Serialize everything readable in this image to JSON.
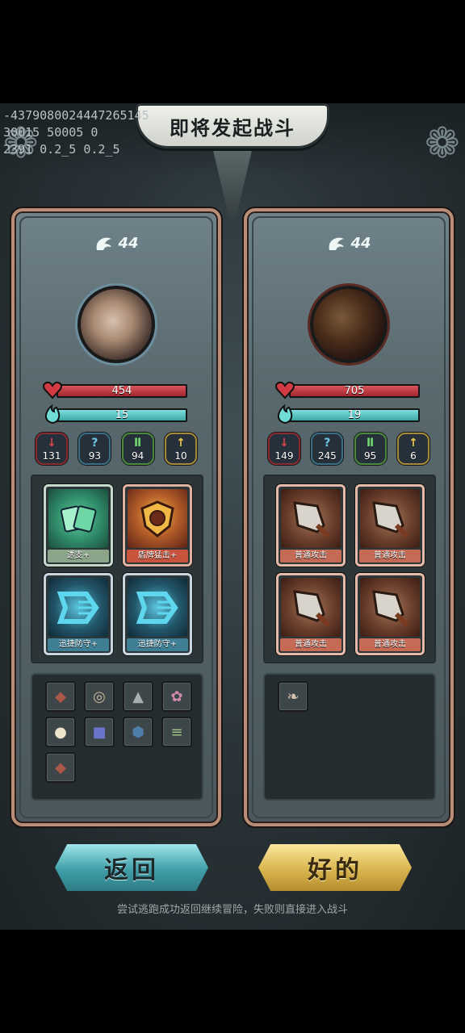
{
  "debug": {
    "line1": "-4379080024447265145",
    "line2": "30015 50005 0",
    "line3": "2391 0.2_5 0.2_5"
  },
  "title": "即将发起战斗",
  "player": {
    "level": "44",
    "hp": "454",
    "mp": "15",
    "stats": [
      "131",
      "93",
      "94",
      "10"
    ],
    "cards": [
      "透支+",
      "盾牌猛击+",
      "迅捷防守+",
      "迅捷防守+"
    ],
    "items": [
      "hood-item",
      "scroll-item",
      "helmet-item",
      "horn-item",
      "bag-item",
      "bracer-item",
      "armor-item",
      "wrap-item",
      "hood-item-2"
    ]
  },
  "enemy": {
    "level": "44",
    "hp": "705",
    "mp": "19",
    "stats": [
      "149",
      "245",
      "95",
      "6"
    ],
    "cards": [
      "普通攻击",
      "普通攻击",
      "普通攻击",
      "普通攻击"
    ],
    "items": [
      "claw-item"
    ]
  },
  "buttons": {
    "back": "返回",
    "ok": "好的"
  },
  "hint": "尝试逃跑成功返回继续冒险，失败则直接进入战斗",
  "colors": {
    "hp": "#c0343c",
    "mp": "#5cc3c3",
    "panel_border": "#b98d78"
  }
}
